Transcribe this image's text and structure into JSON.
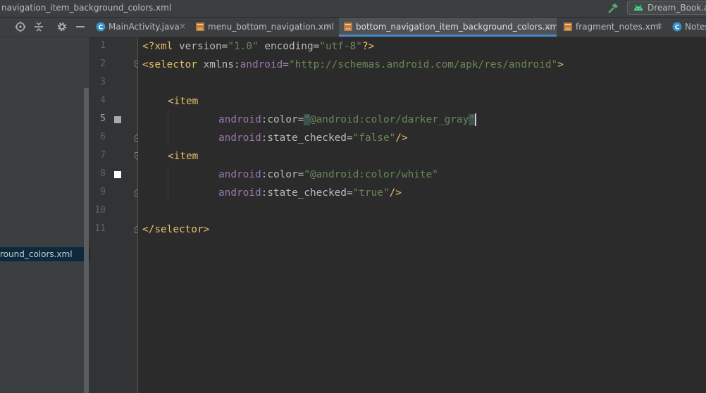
{
  "window": {
    "file_title": "navigation_item_background_colors.xml",
    "run_config_label": "Dream_Book.app"
  },
  "toolbar_icons": [
    "crosshair-icon",
    "collapse-icon",
    "gear-icon",
    "minimize-icon"
  ],
  "tabs": [
    {
      "label": "MainActivity.java",
      "icon": "java-class-icon",
      "active": false
    },
    {
      "label": "menu_bottom_navigation.xml",
      "icon": "xml-file-icon",
      "active": false
    },
    {
      "label": "bottom_navigation_item_background_colors.xml",
      "icon": "xml-file-icon",
      "active": true
    },
    {
      "label": "fragment_notes.xml",
      "icon": "xml-file-icon",
      "active": false
    },
    {
      "label": "Notes",
      "icon": "java-class-icon",
      "active": false
    }
  ],
  "close_glyph": "×",
  "project": {
    "selected_file_label": "round_colors.xml"
  },
  "line_numbers": [
    "1",
    "2",
    "3",
    "4",
    "5",
    "6",
    "7",
    "8",
    "9",
    "10",
    "11"
  ],
  "current_line": 5,
  "gutter_swatches": {
    "line5": "#a9a9a9",
    "line8": "#ffffff"
  },
  "code": {
    "l1": {
      "open": "<?xml ",
      "a1": "version",
      "eq1": "=",
      "v1": "\"1.0\"",
      "sp": " ",
      "a2": "encoding",
      "eq2": "=",
      "v2": "\"utf-8\"",
      "close": "?>"
    },
    "l2": {
      "open": "<selector ",
      "ns": "xmlns",
      "colon": ":",
      "ns2": "android",
      "eq": "=",
      "v": "\"http://schemas.android.com/apk/res/android\"",
      "close": ">"
    },
    "l4": {
      "open": "<item"
    },
    "l5": {
      "ns": "android",
      "attr": ":color",
      "eq": "=",
      "q1": "\"",
      "v": "@android:color/darker_gray",
      "q2": "\""
    },
    "l6": {
      "ns": "android",
      "attr": ":state_checked",
      "eq": "=",
      "v": "\"false\"",
      "close": "/>"
    },
    "l7": {
      "open": "<item"
    },
    "l8": {
      "ns": "android",
      "attr": ":color",
      "eq": "=",
      "v": "\"@android:color/white\""
    },
    "l9": {
      "ns": "android",
      "attr": ":state_checked",
      "eq": "=",
      "v": "\"true\"",
      "close": "/>"
    },
    "l11": {
      "close": "</selector>"
    }
  }
}
